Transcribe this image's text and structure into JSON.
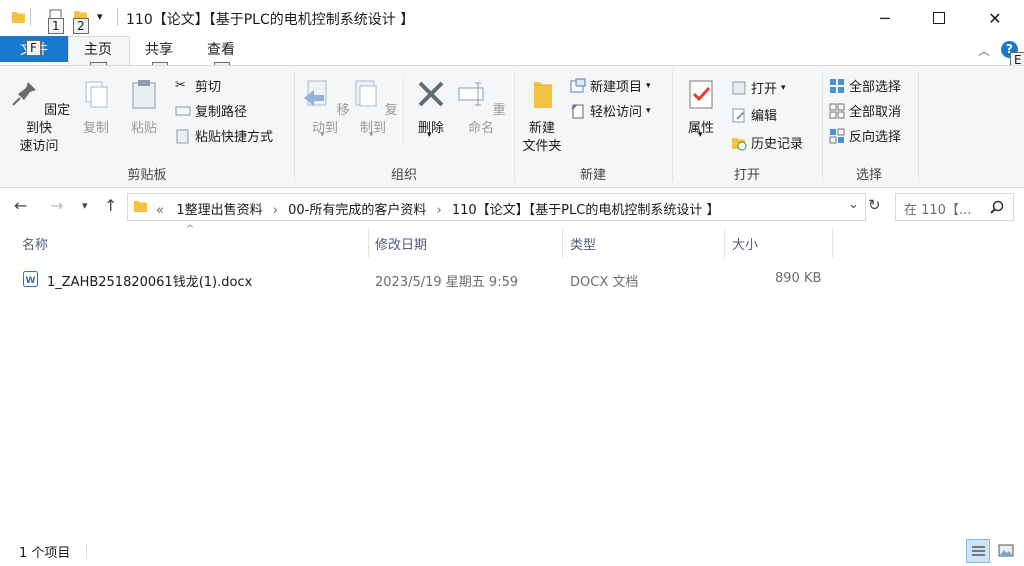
{
  "window": {
    "title": "110【论文】【基于PLC的电机控制系统设计 】",
    "keytips": {
      "qat1": "1",
      "qat2": "2",
      "file": "F",
      "home": "H",
      "share": "S",
      "view": "V",
      "help": "E"
    }
  },
  "tabs": {
    "file": "文件",
    "home": "主页",
    "share": "共享",
    "view": "查看"
  },
  "ribbon": {
    "clipboard": {
      "label": "剪贴板",
      "pin": "固定到快\n速访问",
      "copy": "复制",
      "paste": "粘贴",
      "cut": "剪切",
      "copy_path": "复制路径",
      "paste_shortcut": "粘贴快捷方式"
    },
    "organize": {
      "label": "组织",
      "move_to": "移动到",
      "copy_to": "复制到",
      "delete": "删除",
      "rename": "重命名"
    },
    "new": {
      "label": "新建",
      "new_folder": "新建\n文件夹",
      "new_item": "新建项目",
      "easy_access": "轻松访问"
    },
    "open": {
      "label": "打开",
      "properties": "属性",
      "open": "打开",
      "edit": "编辑",
      "history": "历史记录"
    },
    "select": {
      "label": "选择",
      "select_all": "全部选择",
      "select_none": "全部取消",
      "invert": "反向选择"
    }
  },
  "address": {
    "path": [
      "1整理出售资料",
      "00-所有完成的客户资料",
      "110【论文】【基于PLC的电机控制系统设计 】"
    ],
    "search_placeholder": "在 110【..."
  },
  "columns": {
    "name": "名称",
    "modified": "修改日期",
    "type": "类型",
    "size": "大小"
  },
  "files": [
    {
      "name": "1_ZAHB251820061钱龙(1).docx",
      "modified": "2023/5/19 星期五 9:59",
      "type": "DOCX 文档",
      "size": "890 KB"
    }
  ],
  "status": {
    "count": "1 个项目"
  },
  "colors": {
    "accent": "#1979ca",
    "folder": "#f3c242"
  }
}
